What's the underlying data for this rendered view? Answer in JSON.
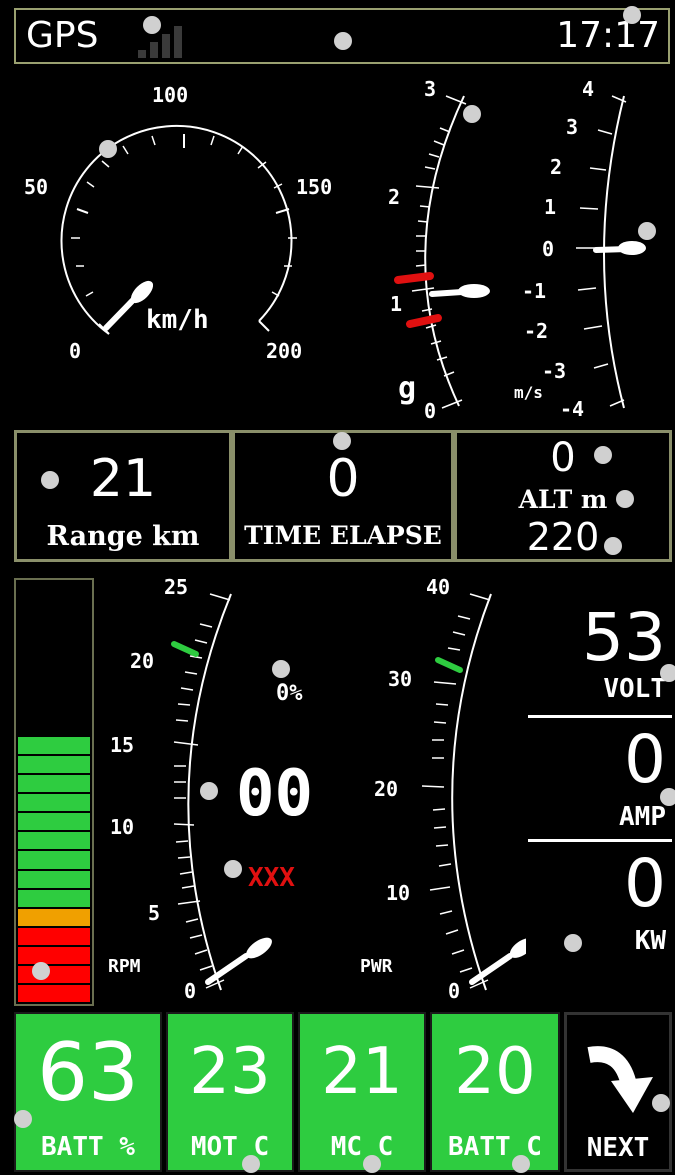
{
  "status": {
    "gps_label": "GPS",
    "clock": "17:17"
  },
  "speed_gauge": {
    "unit": "km/h",
    "ticks": [
      "0",
      "50",
      "100",
      "150",
      "200"
    ]
  },
  "g_gauge": {
    "unit": "g",
    "ticks": [
      "0",
      "1",
      "2",
      "3"
    ]
  },
  "vario_gauge": {
    "unit": "m/s",
    "ticks": [
      "4",
      "3",
      "2",
      "1",
      "0",
      "-1",
      "-2",
      "-3",
      "-4"
    ]
  },
  "range": {
    "value": "21",
    "label": "Range km"
  },
  "time_elapse": {
    "value": "0",
    "label": "TIME ELAPSE"
  },
  "altitude": {
    "value": "0",
    "label": "ALT m",
    "secondary": "220"
  },
  "rpm_gauge": {
    "label": "RPM",
    "ticks": [
      "0",
      "5",
      "10",
      "15",
      "20",
      "25"
    ],
    "value": "00",
    "percent": "0%",
    "warning": "XXX"
  },
  "pwr_gauge": {
    "label": "PWR",
    "ticks": [
      "0",
      "10",
      "20",
      "30",
      "40"
    ]
  },
  "readouts": [
    {
      "value": "53",
      "label": "VOLT"
    },
    {
      "value": "0",
      "label": "AMP"
    },
    {
      "value": "0",
      "label": "KW"
    }
  ],
  "battery_bar": {
    "level_percent": 63
  },
  "tiles": [
    {
      "value": "63",
      "label": "BATT %"
    },
    {
      "value": "23",
      "label": "MOT C"
    },
    {
      "value": "21",
      "label": "MC C"
    },
    {
      "value": "20",
      "label": "BATT C"
    }
  ],
  "next_button": {
    "label": "NEXT"
  }
}
